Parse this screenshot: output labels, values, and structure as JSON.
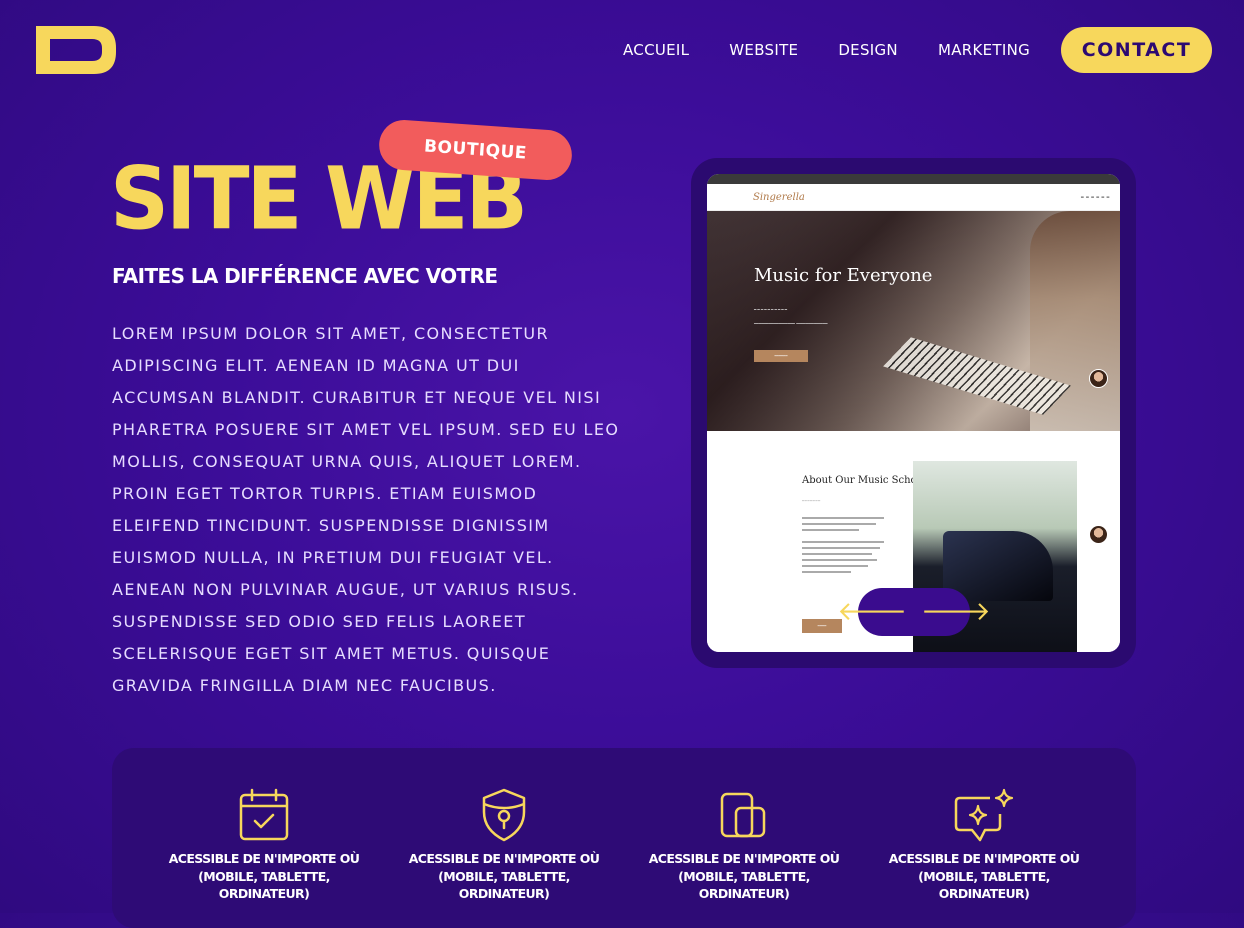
{
  "colors": {
    "accent": "#f7d75c",
    "badge": "#f25c5c",
    "background": "#3c0d99",
    "panel": "#2e0b76"
  },
  "header": {
    "logo_icon": "d-logo-icon",
    "nav": [
      "ACCUEIL",
      "WEBSITE",
      "DESIGN",
      "MARKETING"
    ],
    "contact_label": "CONTACT"
  },
  "hero": {
    "badge": "BOUTIQUE",
    "title": "SITE WEB",
    "subtitle": "FAITES LA DIFFÉRENCE AVEC VOTRE",
    "body": "Lorem ipsum dolor sit amet, consectetur adipiscing elit. Aenean id magna ut dui accumsan blandit. Curabitur et neque vel nisi pharetra posuere sit amet vel ipsum. Sed eu leo mollis, consequat urna quis, aliquet lorem. Proin eget tortor turpis. Etiam euismod eleifend tincidunt. Suspendisse dignissim euismod nulla, in pretium dui feugiat vel. Aenean non pulvinar augue, ut varius risus. Suspendisse sed odio sed felis laoreet scelerisque eget sit amet metus. Quisque gravida fringilla diam nec faucibus."
  },
  "preview": {
    "brand": "Singerella",
    "hero_heading": "Music for Everyone",
    "about_heading": "About Our Music School",
    "arrow_prev": "🡐",
    "arrow_next": "🡒"
  },
  "features": [
    {
      "icon": "calendar-check-icon",
      "text": "ACESSIBLE DE N'IMPORTE OÙ\n(MOBILE, TABLETTE,\nORDINATEUR)"
    },
    {
      "icon": "shield-lock-icon",
      "text": "ACESSIBLE DE N'IMPORTE OÙ\n(MOBILE, TABLETTE,\nORDINATEUR)"
    },
    {
      "icon": "devices-icon",
      "text": "ACESSIBLE DE N'IMPORTE OÙ\n(MOBILE, TABLETTE,\nORDINATEUR)"
    },
    {
      "icon": "chat-sparkle-icon",
      "text": "ACESSIBLE DE N'IMPORTE OÙ\n(MOBILE, TABLETTE,\nORDINATEUR)"
    }
  ]
}
